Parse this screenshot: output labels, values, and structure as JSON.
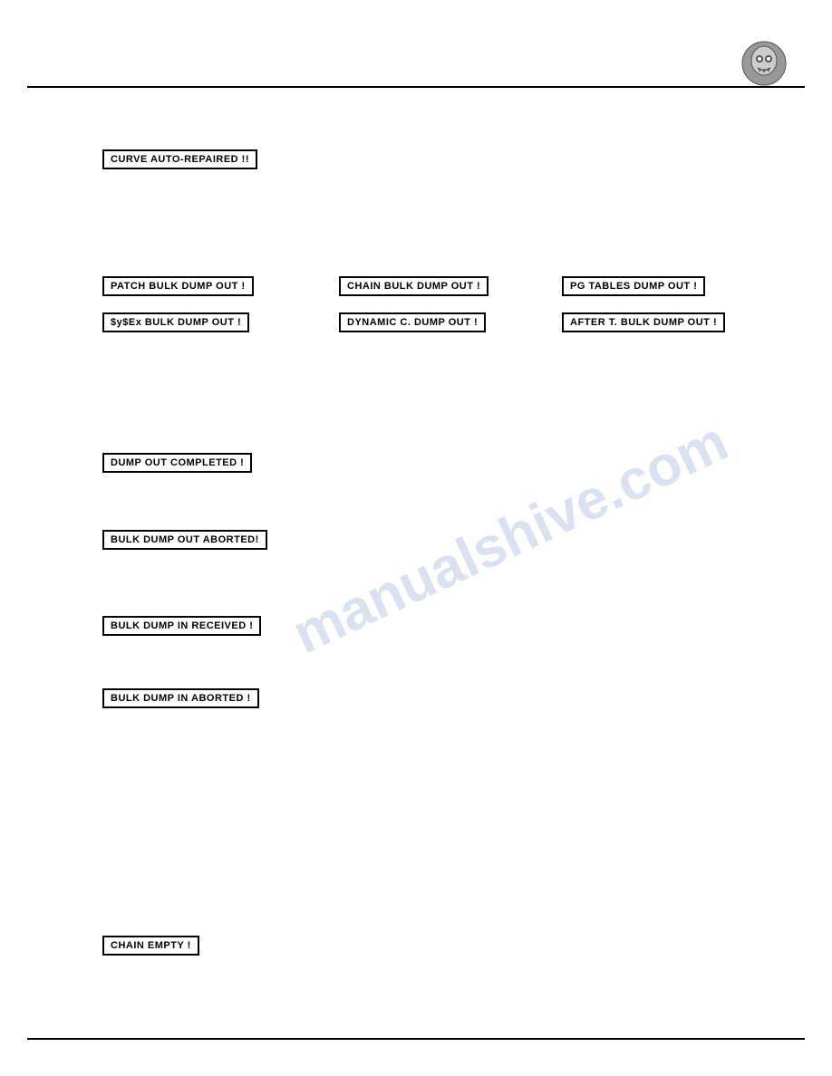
{
  "page": {
    "background": "#ffffff",
    "watermark": "manualshive.com"
  },
  "logo": {
    "alt": "Logo"
  },
  "labels": {
    "curve_auto_repaired": "CURVE AUTO-REPAIRED !!",
    "patch_bulk_dump_out": "PATCH BULK DUMP OUT !",
    "chain_bulk_dump_out": "CHAIN BULK DUMP OUT !",
    "pgtables_dump_out": "PG TABLES DUMP OUT !",
    "sysex_bulk_dump_out": "$y$Ex BULK DUMP OUT !",
    "dynamic_c_dump_out": "DYNAMIC C. DUMP OUT !",
    "after_t_bulk_dump_out": "AFTER T. BULK DUMP OUT !",
    "dump_out_completed": "DUMP OUT COMPLETED !",
    "bulk_dump_out_aborted": "BULK DUMP OUT ABORTED!",
    "bulk_dump_in_received": "BULK DUMP IN RECEIVED !",
    "bulk_dump_in_aborted": "BULK DUMP IN ABORTED !",
    "chain_empty": "CHAIN EMPTY !"
  }
}
